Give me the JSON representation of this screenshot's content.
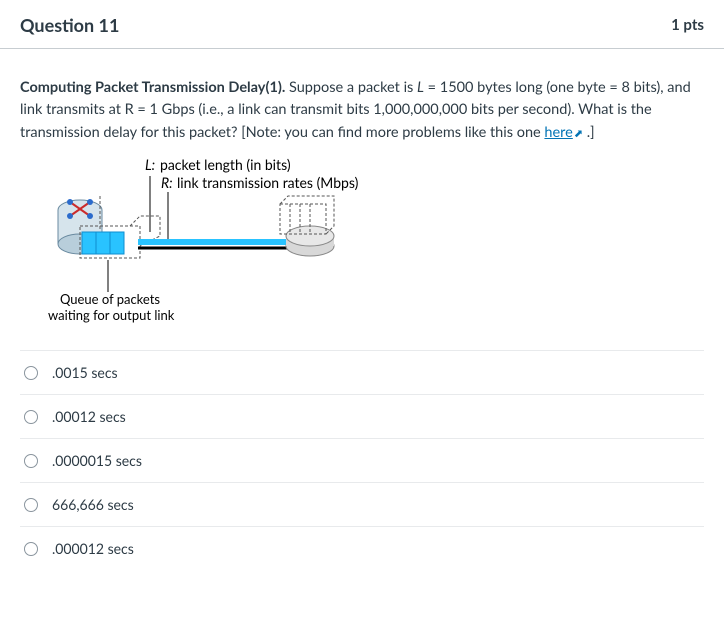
{
  "header": {
    "title": "Question 11",
    "points": "1 pts"
  },
  "prompt": {
    "bold": "Computing Packet Transmission Delay(1).",
    "text1": " Suppose a packet is ",
    "ital1": "L",
    "text2": " = 1500 bytes long (one byte = 8 bits), and link transmits at R = 1 Gbps (i.e., a link can transmit bits 1,000,000,000 bits per second). What is the transmission delay for this packet? [Note: you can find more problems like this one ",
    "link": "here",
    "text3": " .]"
  },
  "diagram": {
    "label_L_pre": "L:",
    "label_L": " packet length (in bits)",
    "label_R_pre": "R:",
    "label_R": " link transmission rates (Mbps)",
    "queue_label1": "Queue of packets",
    "queue_label2": "waiting for output link"
  },
  "answers": [
    {
      "label": ".0015 secs"
    },
    {
      "label": ".00012 secs"
    },
    {
      "label": ".0000015 secs"
    },
    {
      "label": "666,666 secs"
    },
    {
      "label": ".000012 secs"
    }
  ]
}
